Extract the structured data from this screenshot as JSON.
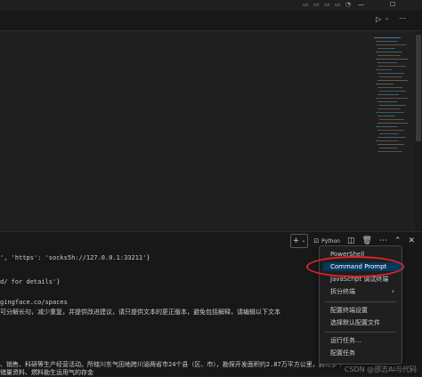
{
  "titlebar": {
    "run_icon": "run-icon",
    "dropdown_icon": "chevron-down-icon",
    "more_icon": "ellipsis-icon"
  },
  "terminal": {
    "toolbar": {
      "add_icon": "plus-icon",
      "profile_label": "Python",
      "split_icon": "split-icon",
      "trash_icon": "trash-icon",
      "more_icon": "ellipsis-icon",
      "collapse_icon": "chevron-up-icon",
      "close_icon": "close-icon"
    },
    "lines": [
      "', 'https': 'socks5h://127.0.0.1:33211'}",
      "d/ for details'}",
      "gingface.co/spaces",
      "可分解长句，减少重复，并提供改进建议，请只提供文本的更正版本，避免包括解释，请编辑以下文本",
      "、销售、科研等生产经营活动。所辖川东气田地跨川渝两省市24个县（区、市），勘探开发面积约2.87万平方公里，拥有多个",
      "储量资料、燃料勘生运用气的存金"
    ]
  },
  "dropdown_menu": {
    "items": [
      "PowerShell",
      "Command Prompt",
      "JavaScript 调试终端",
      "拆分终端",
      "配置终端设置",
      "选择默认配置文件",
      "运行任务...",
      "配置任务"
    ],
    "selected": "Command Prompt"
  },
  "watermark": "CSDN @邵志AI与代码",
  "colors": {
    "accent": "#04395e",
    "highlight_ring": "#e0242a"
  }
}
